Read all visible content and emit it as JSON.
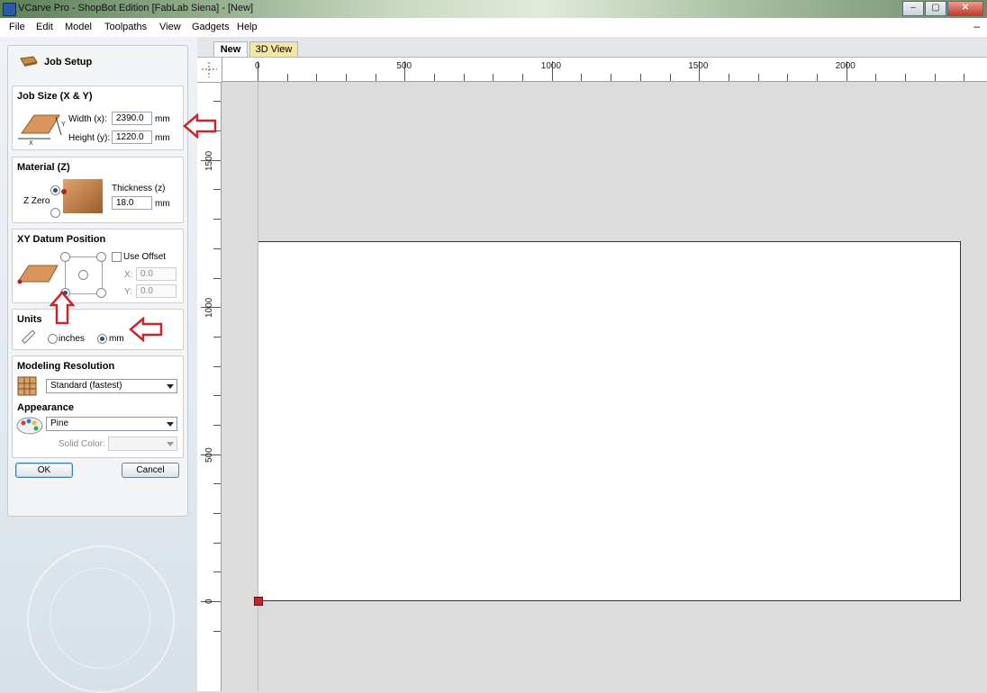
{
  "window": {
    "title": "VCarve Pro - ShopBot Edition [FabLab Siena] - [New]",
    "min_glyph": "‒",
    "max_glyph": "▢",
    "close_glyph": "✕"
  },
  "menu": {
    "items": [
      "File",
      "Edit",
      "Model",
      "Toolpaths",
      "View",
      "Gadgets",
      "Help"
    ],
    "minimize_glyph": "–"
  },
  "job_setup": {
    "title": "Job Setup",
    "job_size": {
      "title": "Job Size (X & Y)",
      "width_label": "Width (x):",
      "width_value": "2390.0",
      "height_label": "Height (y):",
      "height_value": "1220.0",
      "unit": "mm",
      "axis_x": "X",
      "axis_y": "Y"
    },
    "material": {
      "title": "Material (Z)",
      "zzero_label": "Z Zero",
      "thickness_label": "Thickness (z)",
      "thickness_value": "18.0",
      "unit": "mm"
    },
    "datum": {
      "title": "XY Datum Position",
      "use_offset_label": "Use Offset",
      "x_label": "X:",
      "x_value": "0.0",
      "y_label": "Y:",
      "y_value": "0.0"
    },
    "units": {
      "title": "Units",
      "inches_label": "inches",
      "mm_label": "mm",
      "selected": "mm"
    },
    "modeling": {
      "title": "Modeling Resolution",
      "value": "Standard (fastest)"
    },
    "appearance": {
      "title": "Appearance",
      "value": "Pine",
      "solid_color_label": "Solid Color:"
    },
    "ok_label": "OK",
    "cancel_label": "Cancel"
  },
  "tabs": [
    {
      "label": "New",
      "active": true
    },
    {
      "label": "3D View",
      "active": false
    }
  ],
  "rulers": {
    "top_labels": [
      "0",
      "500",
      "1000",
      "1500",
      "2000",
      "2"
    ],
    "left_labels": [
      "1500",
      "1000",
      "500",
      "0"
    ]
  },
  "colors": {
    "annotation_arrow": "#c8262c",
    "datum_marker": "#c0282d",
    "canvas_bg": "#dcdcdc"
  }
}
